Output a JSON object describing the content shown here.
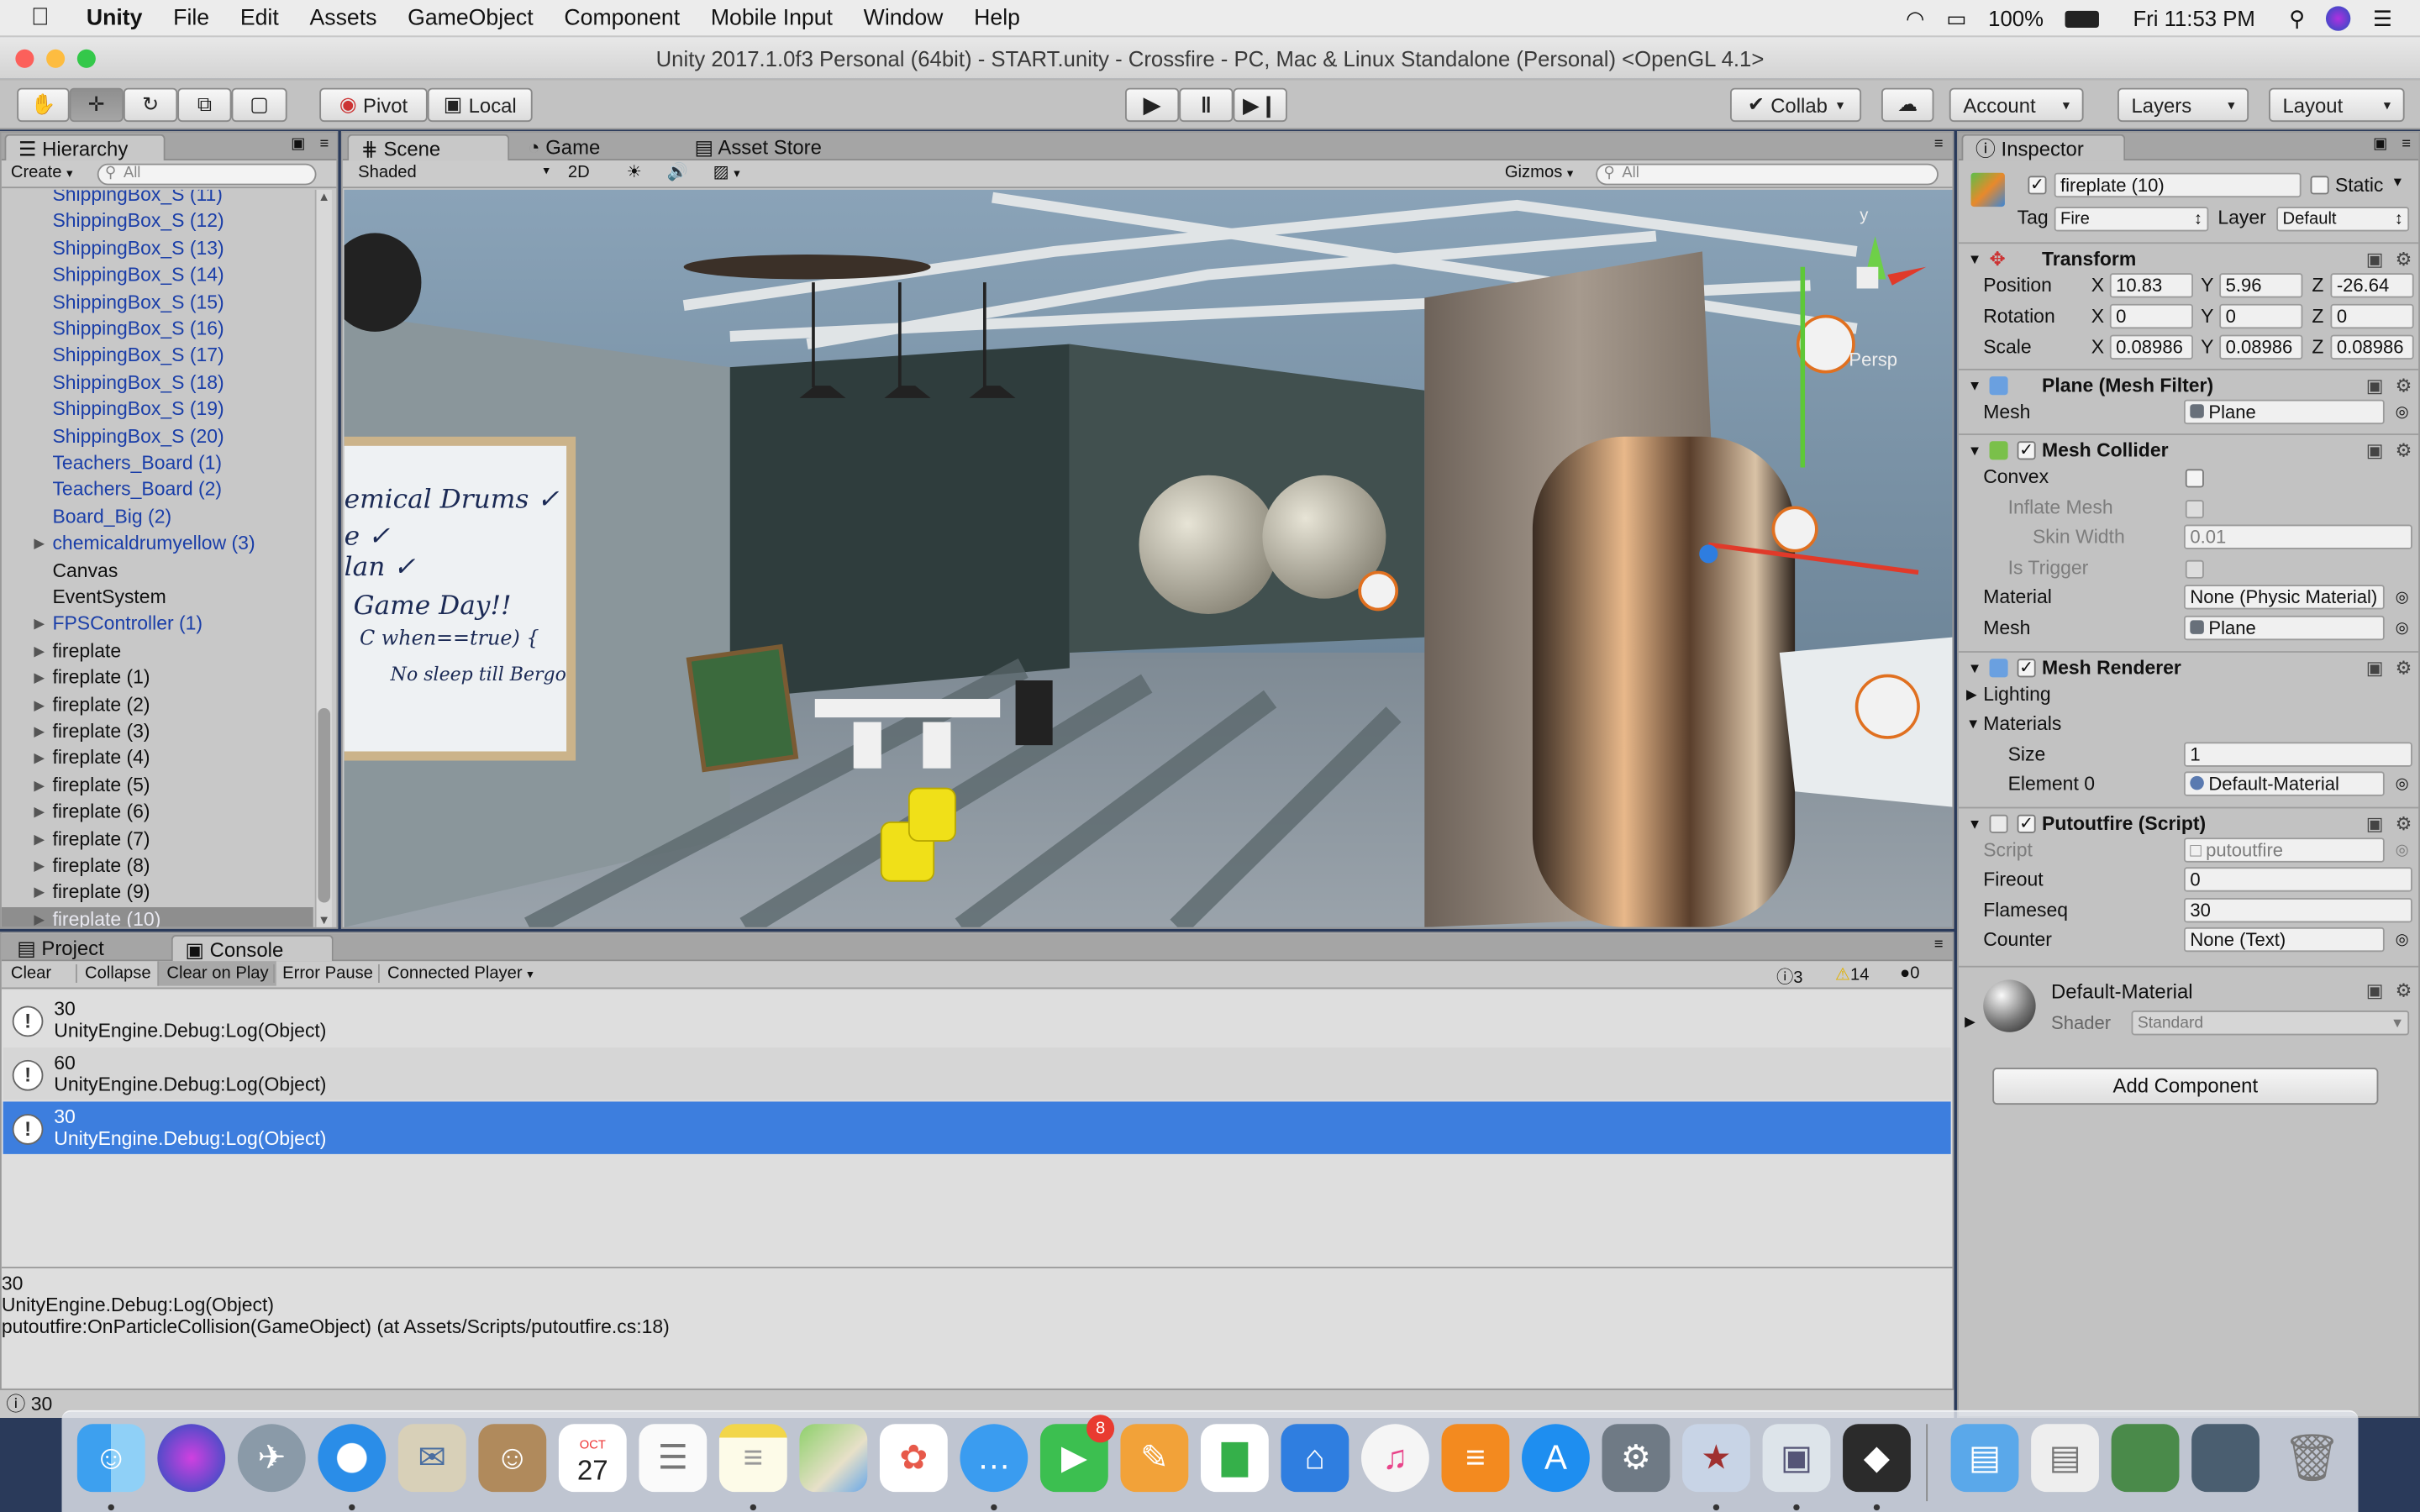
{
  "menubar": {
    "app": "Unity",
    "items": [
      "File",
      "Edit",
      "Assets",
      "GameObject",
      "Component",
      "Mobile Input",
      "Window",
      "Help"
    ],
    "battery": "100%",
    "clock": "Fri 11:53 PM"
  },
  "window": {
    "title": "Unity 2017.1.0f3 Personal (64bit) - START.unity - Crossfire - PC, Mac & Linux Standalone (Personal) <OpenGL 4.1>"
  },
  "toolbar": {
    "pivot": "Pivot",
    "local": "Local",
    "collab": "Collab",
    "account": "Account",
    "layers": "Layers",
    "layout": "Layout"
  },
  "hierarchy": {
    "tab": "Hierarchy",
    "create": "Create",
    "search_placeholder": "All",
    "items": [
      {
        "label": "ShippingBox_S (11)",
        "prefab": true,
        "arrow": false
      },
      {
        "label": "ShippingBox_S (12)",
        "prefab": true,
        "arrow": false
      },
      {
        "label": "ShippingBox_S (13)",
        "prefab": true,
        "arrow": false
      },
      {
        "label": "ShippingBox_S (14)",
        "prefab": true,
        "arrow": false
      },
      {
        "label": "ShippingBox_S (15)",
        "prefab": true,
        "arrow": false
      },
      {
        "label": "ShippingBox_S (16)",
        "prefab": true,
        "arrow": false
      },
      {
        "label": "ShippingBox_S (17)",
        "prefab": true,
        "arrow": false
      },
      {
        "label": "ShippingBox_S (18)",
        "prefab": true,
        "arrow": false
      },
      {
        "label": "ShippingBox_S (19)",
        "prefab": true,
        "arrow": false
      },
      {
        "label": "ShippingBox_S (20)",
        "prefab": true,
        "arrow": false
      },
      {
        "label": "Teachers_Board (1)",
        "prefab": true,
        "arrow": false
      },
      {
        "label": "Teachers_Board (2)",
        "prefab": true,
        "arrow": false
      },
      {
        "label": "Board_Big (2)",
        "prefab": true,
        "arrow": false
      },
      {
        "label": "chemicaldrumyellow (3)",
        "prefab": true,
        "arrow": true
      },
      {
        "label": "Canvas",
        "prefab": false,
        "arrow": false
      },
      {
        "label": "EventSystem",
        "prefab": false,
        "arrow": false
      },
      {
        "label": "FPSController (1)",
        "prefab": true,
        "arrow": true
      },
      {
        "label": "fireplate",
        "prefab": false,
        "arrow": true
      },
      {
        "label": "fireplate (1)",
        "prefab": false,
        "arrow": true
      },
      {
        "label": "fireplate (2)",
        "prefab": false,
        "arrow": true
      },
      {
        "label": "fireplate (3)",
        "prefab": false,
        "arrow": true
      },
      {
        "label": "fireplate (4)",
        "prefab": false,
        "arrow": true
      },
      {
        "label": "fireplate (5)",
        "prefab": false,
        "arrow": true
      },
      {
        "label": "fireplate (6)",
        "prefab": false,
        "arrow": true
      },
      {
        "label": "fireplate (7)",
        "prefab": false,
        "arrow": true
      },
      {
        "label": "fireplate (8)",
        "prefab": false,
        "arrow": true
      },
      {
        "label": "fireplate (9)",
        "prefab": false,
        "arrow": true
      },
      {
        "label": "fireplate (10)",
        "prefab": false,
        "arrow": true,
        "selected": true
      }
    ]
  },
  "scene": {
    "tabs": [
      "Scene",
      "Game",
      "Asset Store"
    ],
    "shading": "Shaded",
    "mode2d": "2D",
    "gizmos": "Gizmos",
    "search_placeholder": "All",
    "persp": "Persp",
    "gizmo_axis_y": "y",
    "board_lines": [
      "emical Drums ✓",
      "e ✓",
      "lan ✓",
      "Game Day!!",
      "C when==true) {",
      "No sleep till Bergo"
    ]
  },
  "console": {
    "tabs": [
      "Project",
      "Console"
    ],
    "buttons": [
      "Clear",
      "Collapse",
      "Clear on Play",
      "Error Pause",
      "Connected Player"
    ],
    "counts": {
      "info": "3",
      "warn": "14",
      "error": "0"
    },
    "rows": [
      {
        "line1": "30",
        "line2": "UnityEngine.Debug:Log(Object)",
        "selected": false
      },
      {
        "line1": "60",
        "line2": "UnityEngine.Debug:Log(Object)",
        "selected": false
      },
      {
        "line1": "30",
        "line2": "UnityEngine.Debug:Log(Object)",
        "selected": true
      }
    ],
    "detail": [
      "30",
      "UnityEngine.Debug:Log(Object)",
      "putoutfire:OnParticleCollision(GameObject) (at Assets/Scripts/putoutfire.cs:18)"
    ]
  },
  "status": {
    "text": "30"
  },
  "inspector": {
    "tab": "Inspector",
    "object_name": "fireplate (10)",
    "static_label": "Static",
    "tag_label": "Tag",
    "tag": "Fire",
    "layer_label": "Layer",
    "layer": "Default",
    "transform": {
      "title": "Transform",
      "position": {
        "label": "Position",
        "x": "10.83",
        "y": "5.96",
        "z": "-26.64"
      },
      "rotation": {
        "label": "Rotation",
        "x": "0",
        "y": "0",
        "z": "0"
      },
      "scale": {
        "label": "Scale",
        "x": "0.08986",
        "y": "0.08986",
        "z": "0.08986"
      }
    },
    "mesh_filter": {
      "title": "Plane (Mesh Filter)",
      "mesh_label": "Mesh",
      "mesh": "Plane"
    },
    "mesh_collider": {
      "title": "Mesh Collider",
      "convex": "Convex",
      "inflate": "Inflate Mesh",
      "skin": "Skin Width",
      "skin_value": "0.01",
      "trigger": "Is Trigger",
      "material_label": "Material",
      "material": "None (Physic Material)",
      "mesh_label": "Mesh",
      "mesh": "Plane"
    },
    "mesh_renderer": {
      "title": "Mesh Renderer",
      "lighting": "Lighting",
      "materials": "Materials",
      "size_label": "Size",
      "size": "1",
      "element_label": "Element 0",
      "element": "Default-Material"
    },
    "script": {
      "title": "Putoutfire (Script)",
      "script_label": "Script",
      "script": "putoutfire",
      "fireout_label": "Fireout",
      "fireout": "0",
      "flameseq_label": "Flameseq",
      "flameseq": "30",
      "counter_label": "Counter",
      "counter": "None (Text)"
    },
    "material": {
      "name": "Default-Material",
      "shader_label": "Shader",
      "shader": "Standard"
    },
    "add_component": "Add Component"
  },
  "dock": {
    "calendar_month": "OCT",
    "calendar_day": "27",
    "facetime_badge": "8"
  },
  "colors": {
    "accent": "#3d7ede",
    "prefab": "#1a3ea8"
  }
}
